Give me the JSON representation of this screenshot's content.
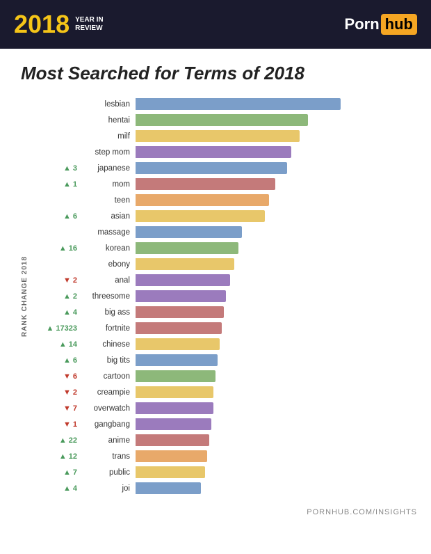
{
  "header": {
    "year": "2018",
    "year_sub": "YEAR IN\nREVIEW",
    "logo_porn": "Porn",
    "logo_hub": "hub"
  },
  "title": "Most Searched for Terms of 2018",
  "y_axis_label": "RANK CHANGE 2018",
  "footer_text": "PORNHUB.COM/INSIGHTS",
  "chart": {
    "max_width": 300,
    "rows": [
      {
        "term": "lesbian",
        "rank_change": "",
        "rank_dir": "none",
        "bar_pct": 1.0,
        "color": "#7b9ec9"
      },
      {
        "term": "hentai",
        "rank_change": "",
        "rank_dir": "none",
        "bar_pct": 0.84,
        "color": "#8db87a"
      },
      {
        "term": "milf",
        "rank_change": "",
        "rank_dir": "none",
        "bar_pct": 0.8,
        "color": "#e8c76a"
      },
      {
        "term": "step mom",
        "rank_change": "",
        "rank_dir": "none",
        "bar_pct": 0.76,
        "color": "#9b7bbd"
      },
      {
        "term": "japanese",
        "rank_change": "3",
        "rank_dir": "up",
        "bar_pct": 0.74,
        "color": "#7b9ec9"
      },
      {
        "term": "mom",
        "rank_change": "1",
        "rank_dir": "up",
        "bar_pct": 0.68,
        "color": "#c47a7a"
      },
      {
        "term": "teen",
        "rank_change": "",
        "rank_dir": "none",
        "bar_pct": 0.65,
        "color": "#e8a96a"
      },
      {
        "term": "asian",
        "rank_change": "6",
        "rank_dir": "up",
        "bar_pct": 0.63,
        "color": "#e8c76a"
      },
      {
        "term": "massage",
        "rank_change": "",
        "rank_dir": "none",
        "bar_pct": 0.52,
        "color": "#7b9ec9"
      },
      {
        "term": "korean",
        "rank_change": "16",
        "rank_dir": "up",
        "bar_pct": 0.5,
        "color": "#8db87a"
      },
      {
        "term": "ebony",
        "rank_change": "",
        "rank_dir": "none",
        "bar_pct": 0.48,
        "color": "#e8c76a"
      },
      {
        "term": "anal",
        "rank_change": "2",
        "rank_dir": "down",
        "bar_pct": 0.46,
        "color": "#9b7bbd"
      },
      {
        "term": "threesome",
        "rank_change": "2",
        "rank_dir": "up",
        "bar_pct": 0.44,
        "color": "#9b7bbd"
      },
      {
        "term": "big ass",
        "rank_change": "4",
        "rank_dir": "up",
        "bar_pct": 0.43,
        "color": "#c47a7a"
      },
      {
        "term": "fortnite",
        "rank_change": "17323",
        "rank_dir": "up",
        "bar_pct": 0.42,
        "color": "#c47a7a"
      },
      {
        "term": "chinese",
        "rank_change": "14",
        "rank_dir": "up",
        "bar_pct": 0.41,
        "color": "#e8c76a"
      },
      {
        "term": "big tits",
        "rank_change": "6",
        "rank_dir": "up",
        "bar_pct": 0.4,
        "color": "#7b9ec9"
      },
      {
        "term": "cartoon",
        "rank_change": "6",
        "rank_dir": "down",
        "bar_pct": 0.39,
        "color": "#8db87a"
      },
      {
        "term": "creampie",
        "rank_change": "2",
        "rank_dir": "down",
        "bar_pct": 0.38,
        "color": "#e8c76a"
      },
      {
        "term": "overwatch",
        "rank_change": "7",
        "rank_dir": "down",
        "bar_pct": 0.38,
        "color": "#9b7bbd"
      },
      {
        "term": "gangbang",
        "rank_change": "1",
        "rank_dir": "down",
        "bar_pct": 0.37,
        "color": "#9b7bbd"
      },
      {
        "term": "anime",
        "rank_change": "22",
        "rank_dir": "up",
        "bar_pct": 0.36,
        "color": "#c47a7a"
      },
      {
        "term": "trans",
        "rank_change": "12",
        "rank_dir": "up",
        "bar_pct": 0.35,
        "color": "#e8a96a"
      },
      {
        "term": "public",
        "rank_change": "7",
        "rank_dir": "up",
        "bar_pct": 0.34,
        "color": "#e8c76a"
      },
      {
        "term": "joi",
        "rank_change": "4",
        "rank_dir": "up",
        "bar_pct": 0.32,
        "color": "#7b9ec9"
      }
    ]
  }
}
